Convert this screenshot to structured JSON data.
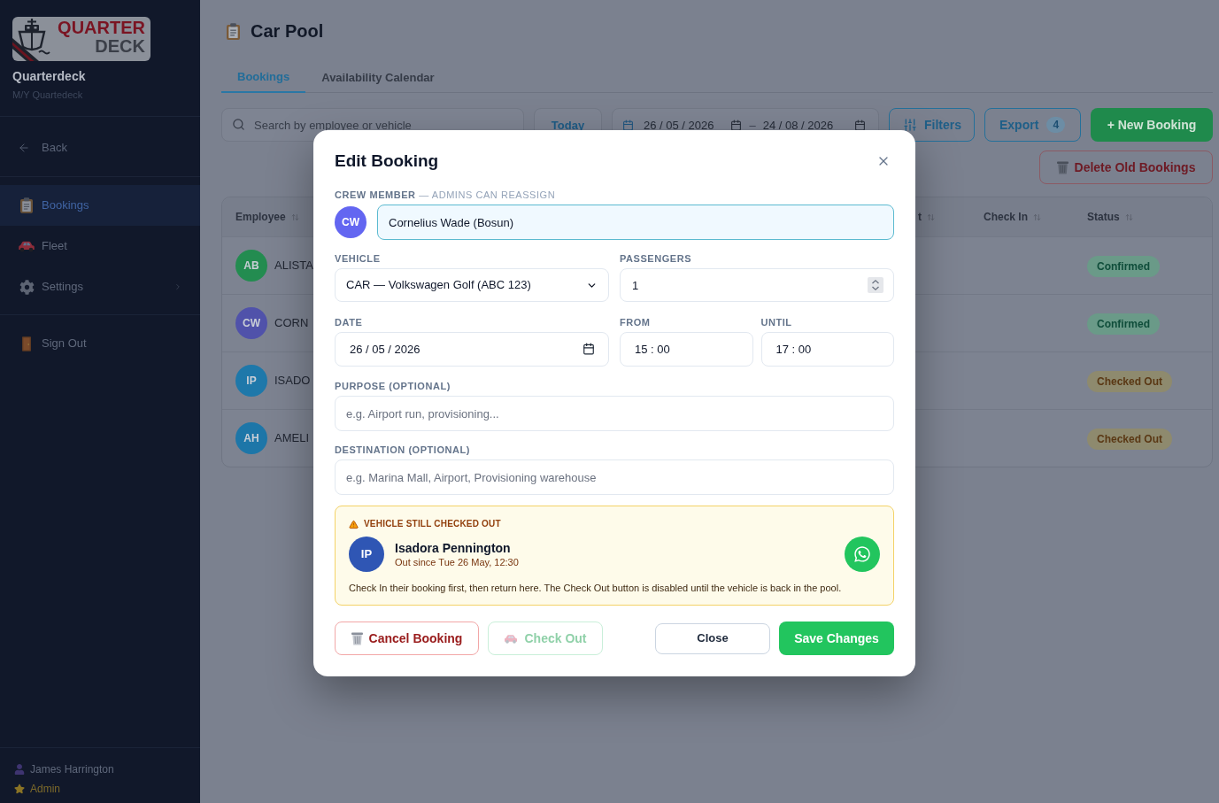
{
  "sidebar": {
    "logo": {
      "top_word": "QUARTER",
      "bottom_word": "DECK"
    },
    "app_name": "Quarterdeck",
    "vessel": "M/Y Quartedeck",
    "back": {
      "label": "Back"
    },
    "items": [
      {
        "label": "Bookings",
        "kind": "link",
        "selected": true
      },
      {
        "label": "Fleet",
        "kind": "link",
        "selected": false
      },
      {
        "label": "Settings",
        "kind": "submenu",
        "selected": false
      }
    ],
    "sign_out": {
      "label": "Sign Out"
    },
    "user": {
      "name": "James Harrington",
      "role": "Admin"
    }
  },
  "header": {
    "title": "Car Pool"
  },
  "tabs": [
    {
      "label": "Bookings",
      "selected": true
    },
    {
      "label": "Availability Calendar",
      "selected": false
    }
  ],
  "toolbar": {
    "search": {
      "placeholder": "Search by employee or vehicle"
    },
    "today_button": "Today",
    "date_range": {
      "from": "26 / 05 / 2026",
      "separator": "–",
      "to": "24 / 08 / 2026"
    },
    "filters_button": "Filters",
    "export_button": {
      "label": "Export",
      "count": "4"
    },
    "new_booking_button": "+ New Booking",
    "delete_old_button": "Delete Old Bookings"
  },
  "table": {
    "columns": [
      {
        "label": "Employee"
      },
      {
        "label": "t"
      },
      {
        "label": "Check In"
      },
      {
        "label": "Status"
      }
    ],
    "rows": [
      {
        "initials": "AB",
        "color": "#238c50",
        "name": "ALISTA",
        "status": {
          "label": "Confirmed",
          "kind": "confirmed"
        }
      },
      {
        "initials": "CW",
        "color": "#5052aa",
        "name": "CORN",
        "status": {
          "label": "Confirmed",
          "kind": "confirmed"
        }
      },
      {
        "initials": "IP",
        "color": "#1e78aa",
        "name": "ISADO",
        "status": {
          "label": "Checked Out",
          "kind": "checked_out"
        }
      },
      {
        "initials": "AH",
        "color": "#1d76a8",
        "name": "AMELI",
        "status": {
          "label": "Checked Out",
          "kind": "checked_out"
        }
      }
    ]
  },
  "modal": {
    "title": "Edit Booking",
    "crew_member": {
      "label": "**CREW MEMBER** — ADMINS CAN REASSIGN",
      "initials": "CW",
      "value": "Cornelius Wade (Bosun)"
    },
    "vehicle": {
      "label": "VEHICLE",
      "value": "CAR — Volkswagen Golf (ABC 123)"
    },
    "passengers": {
      "label": "PASSENGERS",
      "value": "1"
    },
    "date": {
      "label": "DATE",
      "value": "26 / 05 / 2026"
    },
    "from": {
      "label": "FROM",
      "value": "15 : 00"
    },
    "until": {
      "label": "UNTIL",
      "value": "17 : 00"
    },
    "purpose": {
      "label": "PURPOSE (OPTIONAL)",
      "placeholder": "e.g. Airport run, provisioning..."
    },
    "destination": {
      "label": "DESTINATION (OPTIONAL)",
      "placeholder": "e.g. Marina Mall, Airport, Provisioning warehouse"
    },
    "warning": {
      "title": "VEHICLE STILL CHECKED OUT",
      "initials": "IP",
      "name": "Isadora Pennington",
      "since": "Out since Tue 26 May, 12:30",
      "message": "Check In their booking first, then return here. The Check Out button is disabled until the vehicle is back in the pool."
    },
    "actions": [
      {
        "kind": "cancel",
        "label": "Cancel Booking",
        "disabled": false
      },
      {
        "kind": "check_out",
        "label": "Check Out",
        "disabled": true
      },
      {
        "kind": "close",
        "label": "Close",
        "disabled": false
      },
      {
        "kind": "save",
        "label": "Save Changes",
        "disabled": false
      }
    ]
  }
}
